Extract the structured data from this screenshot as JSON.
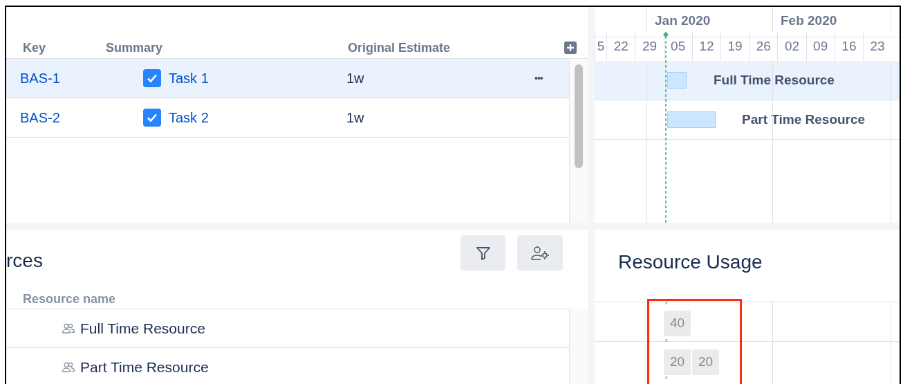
{
  "task_table": {
    "columns": [
      "Key",
      "Summary",
      "Original Estimate"
    ],
    "rows": [
      {
        "key": "BAS-1",
        "summary": "Task 1",
        "checked": true,
        "estimate": "1w",
        "selected": true,
        "menu": "•••"
      },
      {
        "key": "BAS-2",
        "summary": "Task 2",
        "checked": true,
        "estimate": "1w",
        "selected": false
      }
    ]
  },
  "timeline": {
    "months": [
      "Jan 2020",
      "Feb 2020"
    ],
    "weeks": [
      "5",
      "22",
      "29",
      "05",
      "12",
      "19",
      "26",
      "02",
      "09",
      "16",
      "23"
    ],
    "bars": [
      {
        "label": "Full Time Resource",
        "selected": true
      },
      {
        "label": "Part Time Resource",
        "selected": false
      }
    ]
  },
  "resources": {
    "title": "rces",
    "column": "Resource name",
    "rows": [
      "Full Time Resource",
      "Part Time Resource"
    ]
  },
  "usage": {
    "title": "Resource Usage",
    "rows": [
      [
        "40"
      ],
      [
        "20",
        "20"
      ]
    ]
  }
}
